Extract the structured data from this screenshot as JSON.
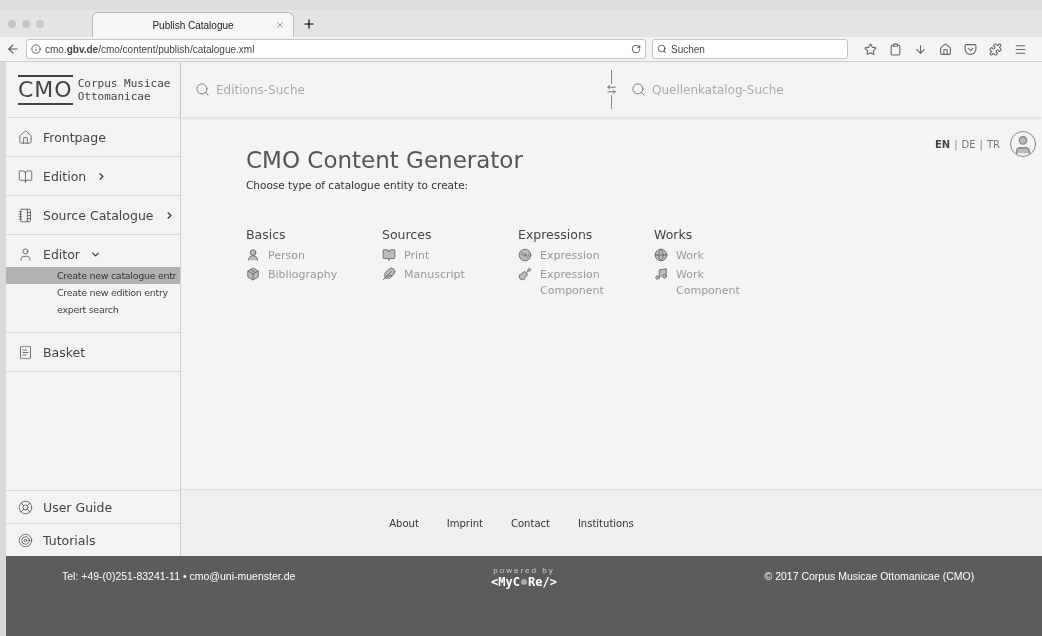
{
  "browser": {
    "tab_title": "Publish Catalogue",
    "url_host": "cmo.",
    "url_domain": "gbv.de",
    "url_path": "/cmo/content/publish/catalogue.xml",
    "search_placeholder": "Suchen"
  },
  "header": {
    "logo_mark": "CMO",
    "logo_line1": "Corpus Musicae",
    "logo_line2": "Ottomanicae",
    "search_left": "Editions-Suche",
    "search_right": "Quellenkatalog-Suche"
  },
  "sidebar": {
    "items": [
      {
        "label": "Frontpage"
      },
      {
        "label": "Edition",
        "expanded": false
      },
      {
        "label": "Source Catalogue",
        "expanded": false
      },
      {
        "label": "Editor",
        "expanded": true,
        "children": [
          {
            "label": "Create new catalogue entr",
            "selected": true
          },
          {
            "label": "Create new edition entry",
            "selected": false
          },
          {
            "label": "expert search",
            "selected": false
          }
        ]
      },
      {
        "label": "Basket"
      }
    ],
    "bottom_items": [
      {
        "label": "User Guide"
      },
      {
        "label": "Tutorials"
      }
    ]
  },
  "languages": [
    {
      "label": "EN",
      "selected": true
    },
    {
      "label": "DE",
      "selected": false
    },
    {
      "label": "TR",
      "selected": false
    }
  ],
  "language_separators": [
    "|",
    "|"
  ],
  "title": "CMO Content Generator",
  "subtitle": "Choose type of catalogue entity to create:",
  "groups": [
    {
      "heading": "Basics",
      "entries": [
        {
          "label": "Person"
        },
        {
          "label": "Bibliography"
        }
      ]
    },
    {
      "heading": "Sources",
      "entries": [
        {
          "label": "Print"
        },
        {
          "label": "Manuscript"
        }
      ]
    },
    {
      "heading": "Expressions",
      "entries": [
        {
          "label": "Expression"
        },
        {
          "label": "Expression Component"
        }
      ]
    },
    {
      "heading": "Works",
      "entries": [
        {
          "label": "Work"
        },
        {
          "label": "Work Component"
        }
      ]
    }
  ],
  "footer_links": [
    "About",
    "Imprint",
    "Contact",
    "Institutions"
  ],
  "footer": {
    "contact": "Tel: +49-(0)251-83241-11 • cmo@uni-muenster.de",
    "powered": "powered by",
    "logo_left": "<MyC",
    "logo_right": "Re/>",
    "copyright": "© 2017 Corpus Musicae Ottomanicae (CMO)"
  }
}
